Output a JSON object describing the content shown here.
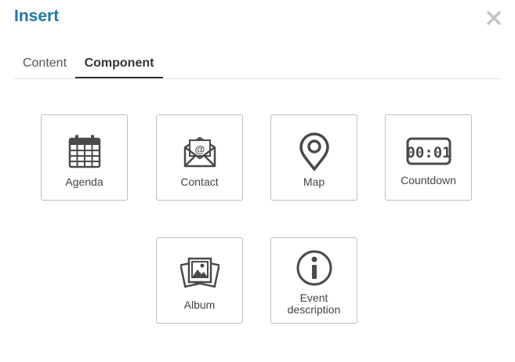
{
  "dialog": {
    "title": "Insert"
  },
  "tabs": [
    {
      "label": "Content"
    },
    {
      "label": "Component"
    }
  ],
  "components": [
    {
      "label": "Agenda",
      "icon": "calendar-icon"
    },
    {
      "label": "Contact",
      "icon": "envelope-icon"
    },
    {
      "label": "Map",
      "icon": "map-pin-icon"
    },
    {
      "label": "Countdown",
      "icon": "countdown-icon",
      "display": "00:01"
    },
    {
      "label": "Album",
      "icon": "photo-album-icon"
    },
    {
      "label": "Event\ndescription",
      "icon": "info-icon"
    }
  ],
  "colors": {
    "title": "#1f77a8",
    "icon": "#4a4a4a",
    "border": "#bdbdbd"
  }
}
